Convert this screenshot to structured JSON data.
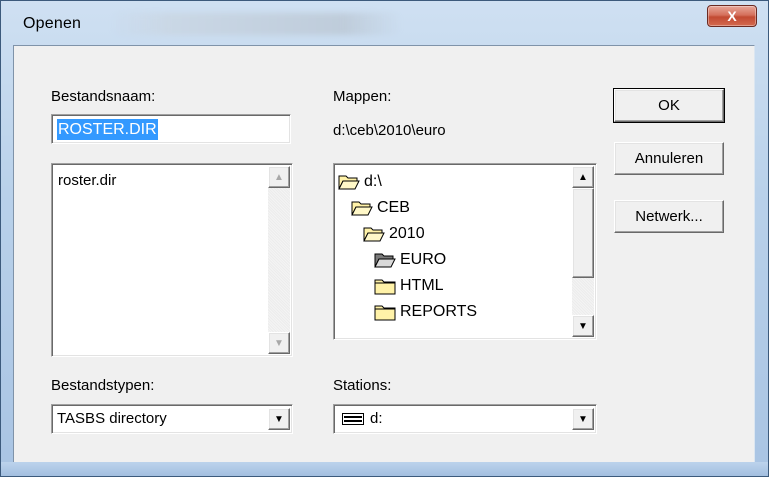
{
  "window": {
    "title": "Openen",
    "close_glyph": "X"
  },
  "filename": {
    "label": "Bestandsnaam:",
    "value": "ROSTER.DIR"
  },
  "files": {
    "items": [
      "roster.dir"
    ],
    "scroll_up_glyph": "▲",
    "scroll_down_glyph": "▼"
  },
  "folders": {
    "label": "Mappen:",
    "current_path": "d:\\ceb\\2010\\euro",
    "tree": [
      {
        "name": "d:\\",
        "icon": "folder-open-icon"
      },
      {
        "name": "CEB",
        "icon": "folder-open-icon"
      },
      {
        "name": "2010",
        "icon": "folder-open-icon"
      },
      {
        "name": "EURO",
        "icon": "folder-open-dark-icon"
      },
      {
        "name": "HTML",
        "icon": "folder-closed-icon"
      },
      {
        "name": "REPORTS",
        "icon": "folder-closed-icon"
      }
    ],
    "scroll_up_glyph": "▲",
    "scroll_down_glyph": "▼"
  },
  "buttons": {
    "ok": "OK",
    "cancel": "Annuleren",
    "network": "Netwerk..."
  },
  "filetypes": {
    "label": "Bestandstypen:",
    "selected": "TASBS directory",
    "arrow_glyph": "▼"
  },
  "drives": {
    "label": "Stations:",
    "selected": "d:",
    "icon": "drive-icon",
    "arrow_glyph": "▼"
  },
  "colors": {
    "selection": "#3399ff",
    "dialog_bg": "#f0f0f0",
    "folder_fill": "#fff2a8",
    "close_button": "#c24a33"
  }
}
